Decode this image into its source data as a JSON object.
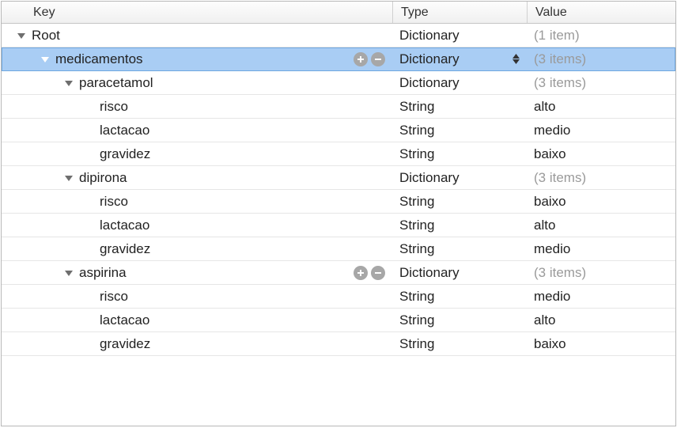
{
  "columns": {
    "key": "Key",
    "type": "Type",
    "value": "Value"
  },
  "types": {
    "dictionary": "Dictionary",
    "string": "String"
  },
  "itemSuffix": {
    "one": "(1 item)",
    "three": "(3 items)"
  },
  "root": {
    "key": "Root",
    "type_ref": "dictionary",
    "value_ref": "one"
  },
  "medicamentos": {
    "key": "medicamentos",
    "type_ref": "dictionary",
    "value_ref": "three"
  },
  "paracetamol": {
    "key": "paracetamol",
    "type_ref": "dictionary",
    "value_ref": "three",
    "risco": {
      "key": "risco",
      "type_ref": "string",
      "value": "alto"
    },
    "lactacao": {
      "key": "lactacao",
      "type_ref": "string",
      "value": "medio"
    },
    "gravidez": {
      "key": "gravidez",
      "type_ref": "string",
      "value": "baixo"
    }
  },
  "dipirona": {
    "key": "dipirona",
    "type_ref": "dictionary",
    "value_ref": "three",
    "risco": {
      "key": "risco",
      "type_ref": "string",
      "value": "baixo"
    },
    "lactacao": {
      "key": "lactacao",
      "type_ref": "string",
      "value": "alto"
    },
    "gravidez": {
      "key": "gravidez",
      "type_ref": "string",
      "value": "medio"
    }
  },
  "aspirina": {
    "key": "aspirina",
    "type_ref": "dictionary",
    "value_ref": "three",
    "risco": {
      "key": "risco",
      "type_ref": "string",
      "value": "medio"
    },
    "lactacao": {
      "key": "lactacao",
      "type_ref": "string",
      "value": "alto"
    },
    "gravidez": {
      "key": "gravidez",
      "type_ref": "string",
      "value": "baixo"
    }
  }
}
